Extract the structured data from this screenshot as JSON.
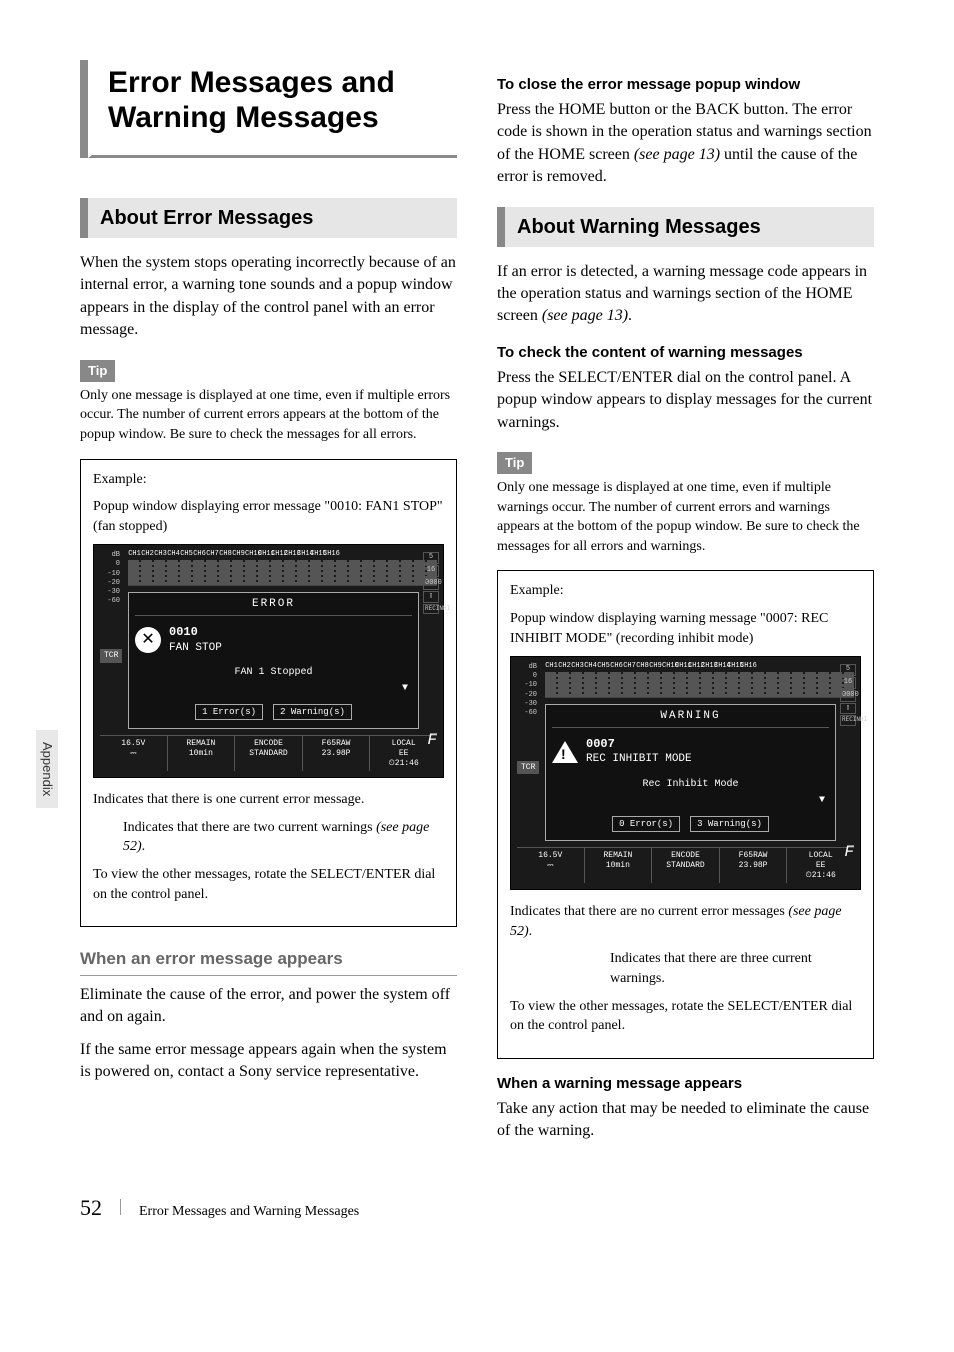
{
  "chapter_title": "Error Messages and Warning Messages",
  "left": {
    "section1_heading": "About Error Messages",
    "intro": "When the system stops operating incorrectly because of an internal error, a warning tone sounds and a popup window appears in the display of the control panel with an error message.",
    "tip_label": "Tip",
    "tip_text": "Only one message is displayed at one time, even if multiple errors occur. The number of current errors appears at the bottom of the popup window. Be sure to check the messages for all errors.",
    "example_label": "Example:",
    "example_desc": "Popup window displaying error message \"0010: FAN1 STOP\" (fan stopped)",
    "screen": {
      "title": "ERROR",
      "code": "0010",
      "msg": "FAN STOP",
      "sub": "FAN 1 Stopped",
      "errcount": "1 Error(s)",
      "warncount": "2 Warning(s)",
      "tcr": "TCR",
      "f_label": "F",
      "status": {
        "volt": "16.5V",
        "remain_label": "REMAIN",
        "remain": "10min",
        "encode_label": "ENCODE",
        "encode": "STANDARD",
        "raw": "F65RAW",
        "fps": "23.98P",
        "local": "LOCAL",
        "ee": "EE",
        "clock": "21:46",
        "zero": "0000"
      }
    },
    "callout1": "Indicates that there is one current error message.",
    "callout2_pre": "Indicates that there are two current warnings ",
    "callout2_ref": "(see page 52)",
    "callout2_post": ".",
    "view_other": "To view the other messages, rotate the SELECT/ENTER dial on the control panel.",
    "subhead_grey": "When an error message appears",
    "remedy1": "Eliminate the cause of the error, and power the system off and on again.",
    "remedy2": "If the same error message appears again when the system is powered on, contact a Sony service representative."
  },
  "right": {
    "subhead1": "To close the error message popup window",
    "close_text_pre": "Press the HOME button or the BACK button. The error code is shown in the operation status and warnings section of the HOME screen ",
    "close_text_ref": "(see page 13)",
    "close_text_post": " until the cause of the error is removed.",
    "section_heading": "About Warning Messages",
    "warn_intro_pre": "If an error is detected, a warning message code appears in the operation status and warnings section of the HOME screen ",
    "warn_intro_ref": "(see page 13)",
    "warn_intro_post": ".",
    "subhead2": "To check the content of warning messages",
    "check_text": "Press the SELECT/ENTER dial on the control panel. A popup window appears to display messages for the current warnings.",
    "tip_label": "Tip",
    "tip_text": "Only one message is displayed at one time, even if multiple warnings occur. The number of current errors and warnings appears at the bottom of the popup window. Be sure to check the messages for all errors and warnings.",
    "example_label": "Example:",
    "example_desc": "Popup window displaying warning message \"0007: REC INHIBIT MODE\" (recording inhibit mode)",
    "screen": {
      "title": "WARNING",
      "code": "0007",
      "msg": "REC INHIBIT MODE",
      "sub": "Rec Inhibit Mode",
      "errcount": "0 Error(s)",
      "warncount": "3 Warning(s)",
      "tcr": "TCR",
      "f_label": "F",
      "status": {
        "volt": "16.5V",
        "remain_label": "REMAIN",
        "remain": "10min",
        "encode_label": "ENCODE",
        "encode": "STANDARD",
        "raw": "F65RAW",
        "fps": "23.98P",
        "local": "LOCAL",
        "ee": "EE",
        "clock": "21:46",
        "zero": "0000",
        "recinh": "RECINHI"
      }
    },
    "callout1_pre": "Indicates that there are no current error messages ",
    "callout1_ref": "(see page 52)",
    "callout1_post": ".",
    "callout2": "Indicates that there are three current warnings.",
    "view_other": "To view the other messages, rotate the SELECT/ENTER dial on the control panel.",
    "subhead3": "When a warning message appears",
    "remedy": "Take any action that may be needed to eliminate the cause of the warning."
  },
  "side_tab": "Appendix",
  "footer": {
    "page": "52",
    "title": "Error Messages and Warning Messages"
  },
  "db_labels": [
    "dB",
    "0",
    "-10",
    "-20",
    "-30",
    "-60"
  ],
  "channel_headers": [
    "CH1",
    "CH2",
    "CH3",
    "CH4",
    "CH5",
    "CH6",
    "CH7",
    "CH8",
    "CH9",
    "CH10",
    "CH11",
    "CH12",
    "CH13",
    "CH14",
    "CH15",
    "CH16"
  ]
}
